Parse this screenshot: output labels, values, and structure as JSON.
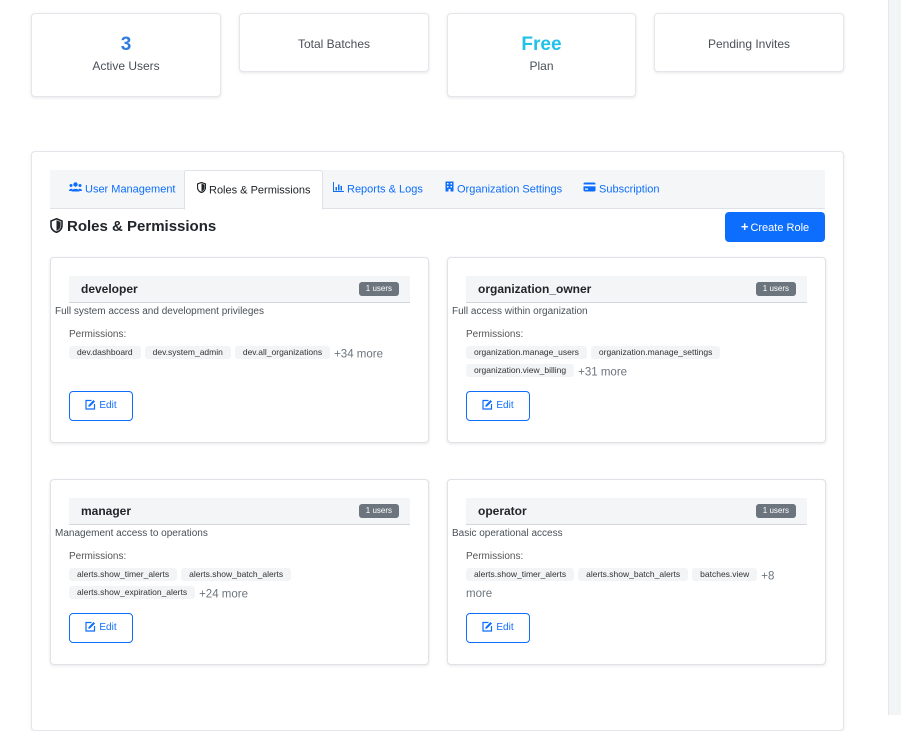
{
  "stats": [
    {
      "value": "3",
      "label": "Active Users"
    },
    {
      "value": "",
      "label": "Total Batches"
    },
    {
      "value": "Free",
      "label": "Plan"
    },
    {
      "value": "",
      "label": "Pending Invites"
    }
  ],
  "tabs": [
    {
      "label": "User Management",
      "icon": "users-icon"
    },
    {
      "label": "Roles & Permissions",
      "icon": "shield-icon"
    },
    {
      "label": "Reports & Logs",
      "icon": "chart-bar-icon"
    },
    {
      "label": "Organization Settings",
      "icon": "building-icon"
    },
    {
      "label": "Subscription",
      "icon": "credit-card-icon"
    }
  ],
  "active_tab": "Roles & Permissions",
  "section": {
    "title": "Roles & Permissions",
    "create_button": "Create Role"
  },
  "roles": [
    {
      "name": "developer",
      "users_badge": "1 users",
      "description": "Full system access and development privileges",
      "permissions_label": "Permissions:",
      "permissions": [
        "dev.dashboard",
        "dev.system_admin",
        "dev.all_organizations"
      ],
      "more": "+34 more",
      "edit_label": "Edit"
    },
    {
      "name": "organization_owner",
      "users_badge": "1 users",
      "description": "Full access within organization",
      "permissions_label": "Permissions:",
      "permissions": [
        "organization.manage_users",
        "organization.manage_settings",
        "organization.view_billing"
      ],
      "more": "+31 more",
      "edit_label": "Edit"
    },
    {
      "name": "manager",
      "users_badge": "1 users",
      "description": "Management access to operations",
      "permissions_label": "Permissions:",
      "permissions": [
        "alerts.show_timer_alerts",
        "alerts.show_batch_alerts",
        "alerts.show_expiration_alerts"
      ],
      "more": "+24 more",
      "edit_label": "Edit"
    },
    {
      "name": "operator",
      "users_badge": "1 users",
      "description": "Basic operational access",
      "permissions_label": "Permissions:",
      "permissions": [
        "alerts.show_timer_alerts",
        "alerts.show_batch_alerts",
        "batches.view"
      ],
      "more": "+8 more",
      "edit_label": "Edit"
    }
  ],
  "colors": {
    "primary": "#0d6efd",
    "stat_blue": "#2f7ddf",
    "stat_cyan": "#22c2e8",
    "badge_gray": "#6c757d"
  }
}
